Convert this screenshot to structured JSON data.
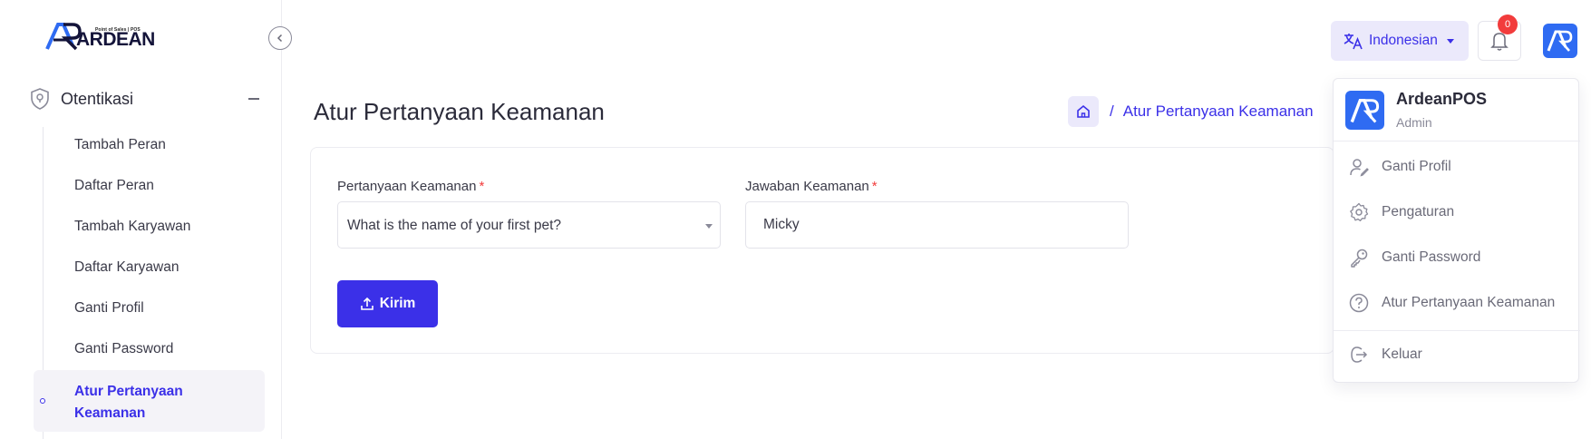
{
  "brand": {
    "logo_text": "ARDEAN",
    "tagline": "Point of Sales | POS"
  },
  "sidebar": {
    "group_label": "Otentikasi",
    "items": [
      {
        "label": "Tambah Peran"
      },
      {
        "label": "Daftar Peran"
      },
      {
        "label": "Tambah Karyawan"
      },
      {
        "label": "Daftar Karyawan"
      },
      {
        "label": "Ganti Profil"
      },
      {
        "label": "Ganti Password"
      },
      {
        "label": "Atur Pertanyaan Keamanan",
        "active": true
      }
    ]
  },
  "header": {
    "language": "Indonesian",
    "notification_count": "0"
  },
  "page": {
    "title": "Atur Pertanyaan Keamanan",
    "breadcrumb_current": "Atur Pertanyaan Keamanan"
  },
  "form": {
    "question_label": "Pertanyaan Keamanan",
    "question_value": "What is the name of your first pet?",
    "answer_label": "Jawaban Keamanan",
    "answer_value": "Micky",
    "required_mark": "*",
    "submit_label": "Kirim"
  },
  "user_menu": {
    "name": "ArdeanPOS",
    "role": "Admin",
    "items": [
      {
        "label": "Ganti Profil",
        "icon": "user-edit-icon"
      },
      {
        "label": "Pengaturan",
        "icon": "gear-icon"
      },
      {
        "label": "Ganti Password",
        "icon": "key-icon"
      },
      {
        "label": "Atur Pertanyaan Keamanan",
        "icon": "question-circle-icon"
      },
      {
        "label": "Keluar",
        "icon": "logout-icon"
      }
    ]
  },
  "colors": {
    "accent": "#3b30e8",
    "accent_light": "#ebe9fb",
    "badge": "#f23c3c",
    "avatar_blue": "#2f6bf2"
  }
}
